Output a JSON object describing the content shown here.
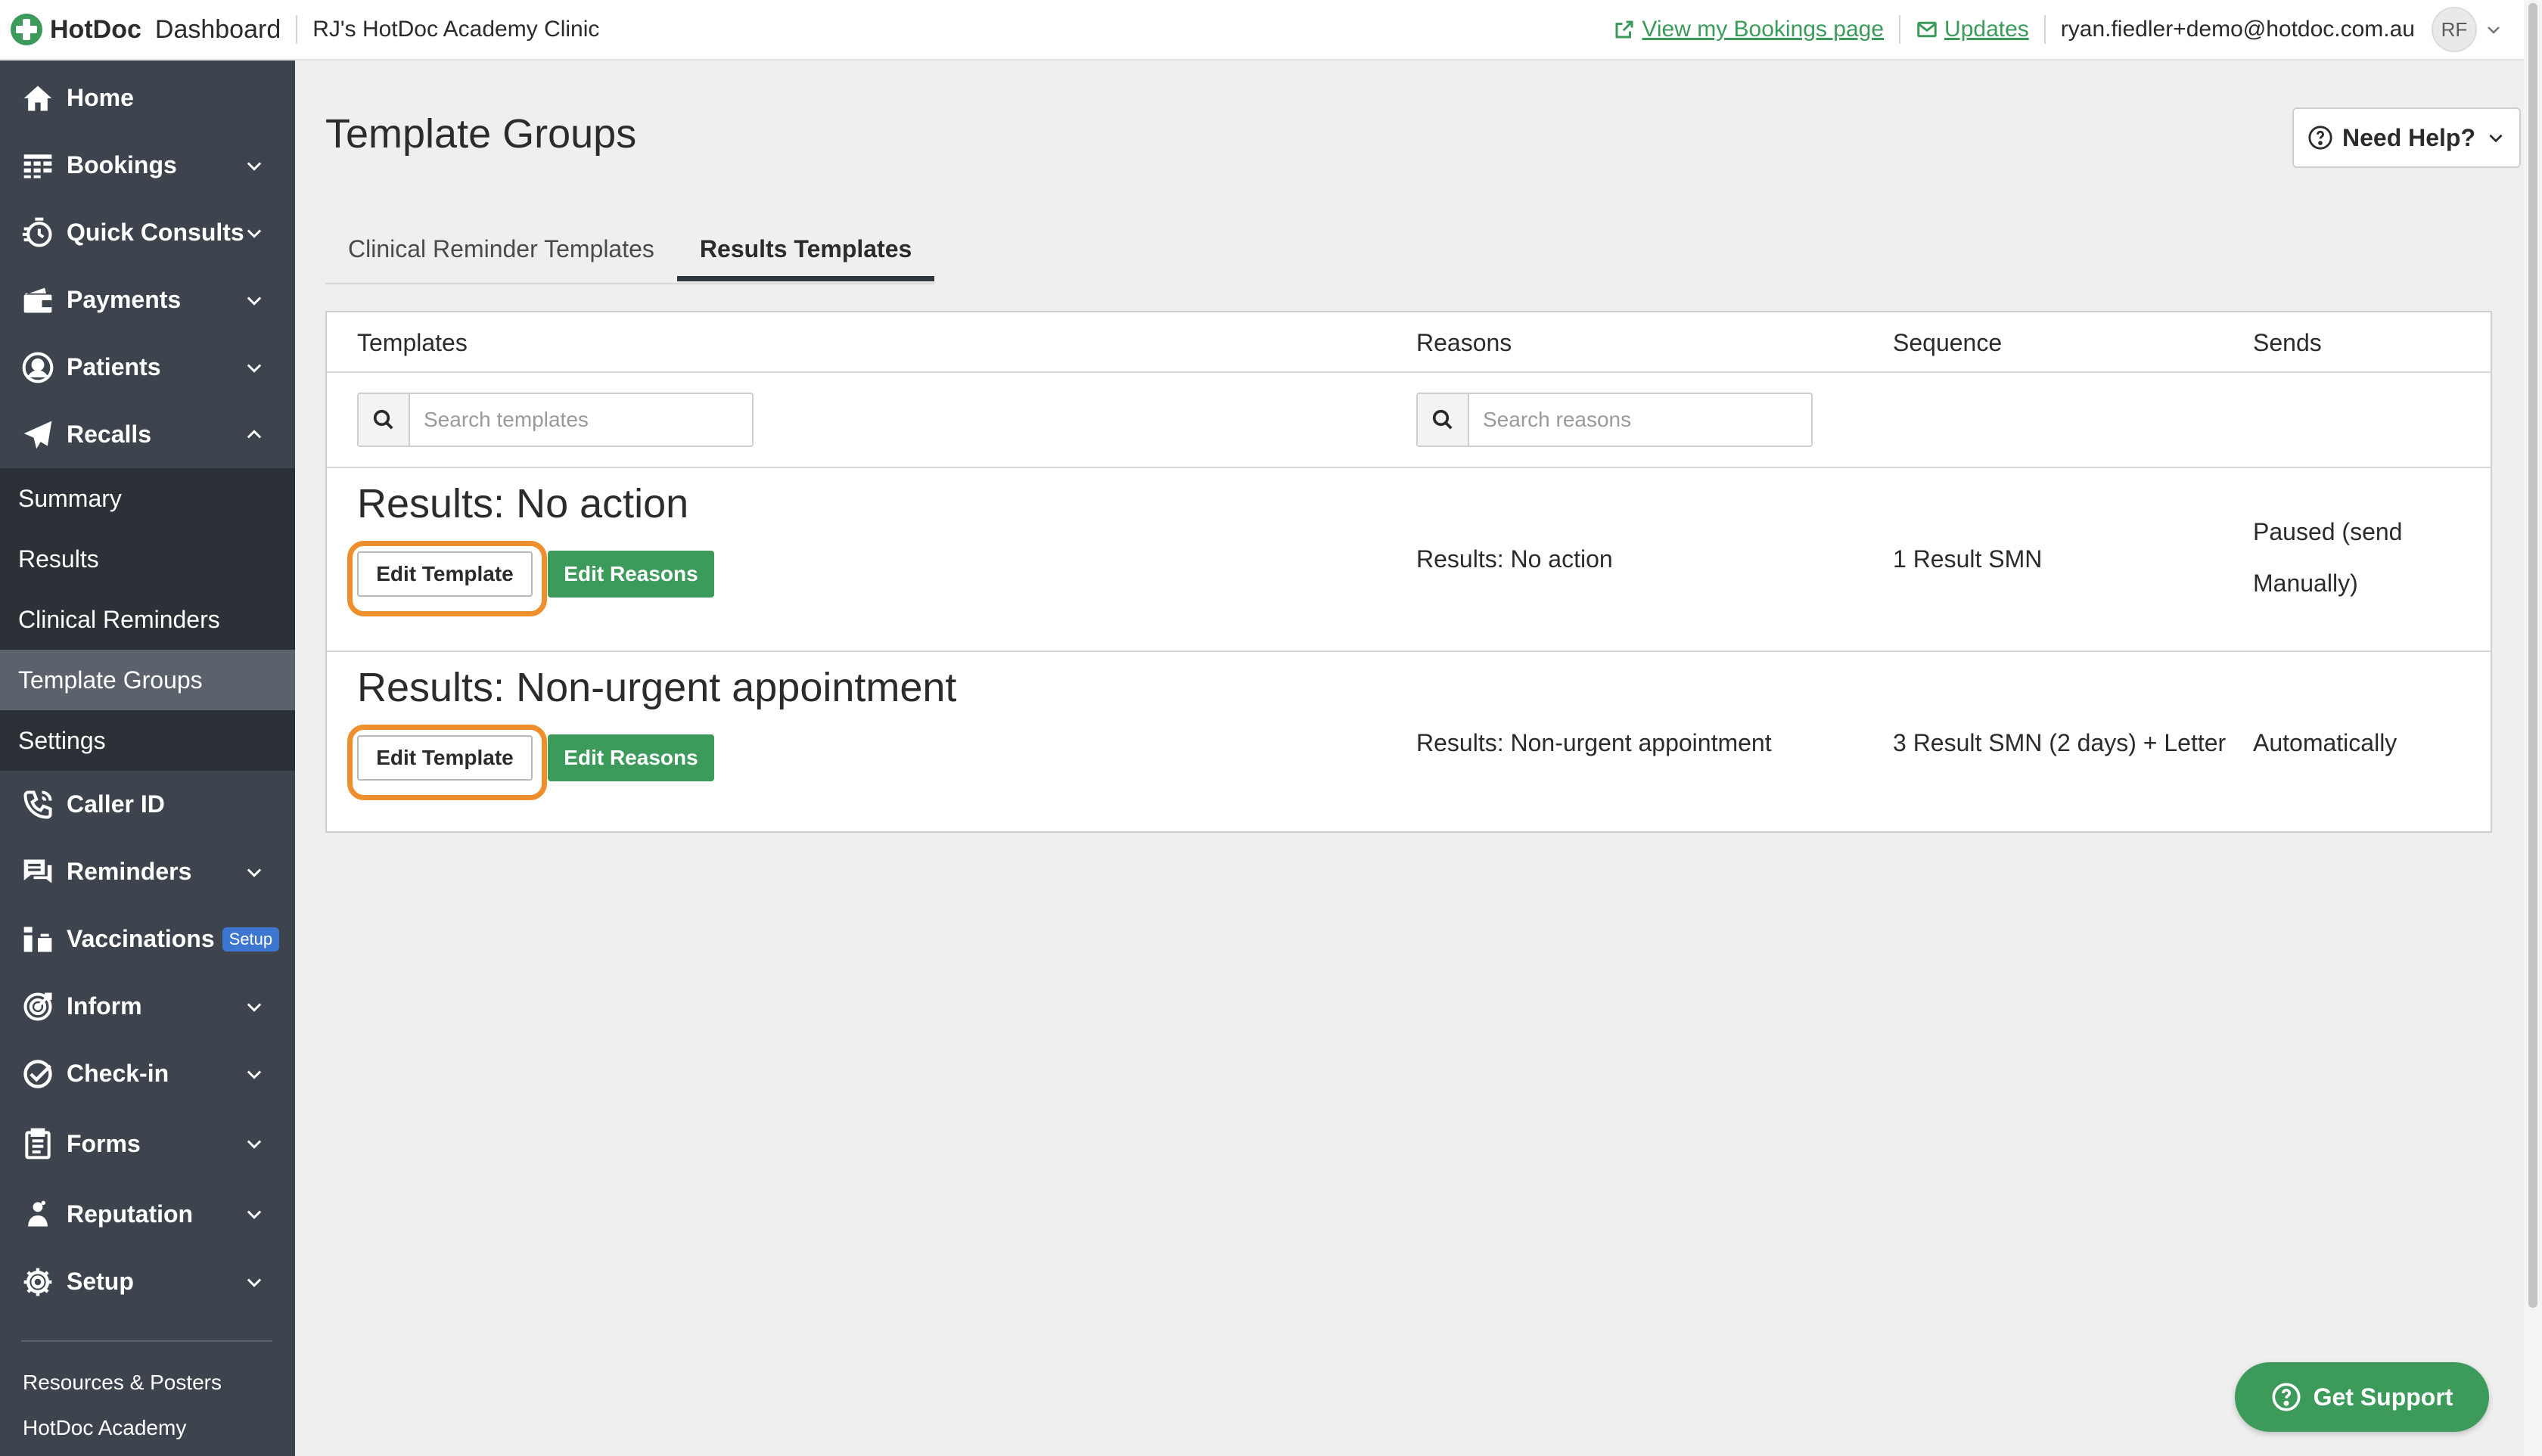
{
  "topbar": {
    "brand_name": "HotDoc",
    "brand_sub": "Dashboard",
    "clinic": "RJ's HotDoc Academy Clinic",
    "bookings_link": "View my Bookings page",
    "updates_link": "Updates",
    "email": "ryan.fiedler+demo@hotdoc.com.au",
    "avatar_initials": "RF"
  },
  "sidebar": {
    "items": [
      {
        "label": "Home"
      },
      {
        "label": "Bookings"
      },
      {
        "label": "Quick Consults"
      },
      {
        "label": "Payments"
      },
      {
        "label": "Patients"
      },
      {
        "label": "Recalls"
      },
      {
        "label": "Caller ID"
      },
      {
        "label": "Reminders"
      },
      {
        "label": "Vaccinations",
        "badge": "Setup"
      },
      {
        "label": "Inform"
      },
      {
        "label": "Check-in"
      },
      {
        "label": "Forms"
      },
      {
        "label": "Reputation"
      },
      {
        "label": "Setup"
      }
    ],
    "recalls_sub": [
      "Summary",
      "Results",
      "Clinical Reminders",
      "Template Groups",
      "Settings"
    ],
    "active_sub": "Template Groups",
    "footer_links": [
      "Resources & Posters",
      "HotDoc Academy"
    ]
  },
  "main": {
    "title": "Template Groups",
    "help_button": "Need Help?",
    "tabs": [
      {
        "label": "Clinical Reminder Templates",
        "active": false
      },
      {
        "label": "Results Templates",
        "active": true
      }
    ],
    "table": {
      "headers": [
        "Templates",
        "Reasons",
        "Sequence",
        "Sends"
      ],
      "search_templates_placeholder": "Search templates",
      "search_reasons_placeholder": "Search reasons",
      "rows": [
        {
          "title": "Results: No action",
          "edit_template": "Edit Template",
          "edit_reasons": "Edit Reasons",
          "reason": "Results: No action",
          "sequence": "1 Result SMN",
          "sends_line1": "Paused (send",
          "sends_line2": "Manually)"
        },
        {
          "title": "Results: Non-urgent appointment",
          "edit_template": "Edit Template",
          "edit_reasons": "Edit Reasons",
          "reason": "Results: Non-urgent appointment",
          "sequence": "3 Result SMN (2 days) + Letter",
          "sends_line1": "Automatically",
          "sends_line2": ""
        }
      ]
    }
  },
  "support_button": "Get Support",
  "colors": {
    "brand_green": "#3c9a5a",
    "sidebar_bg": "#3d444d",
    "highlight_orange": "#ee8f2e",
    "badge_blue": "#3d76d1"
  }
}
